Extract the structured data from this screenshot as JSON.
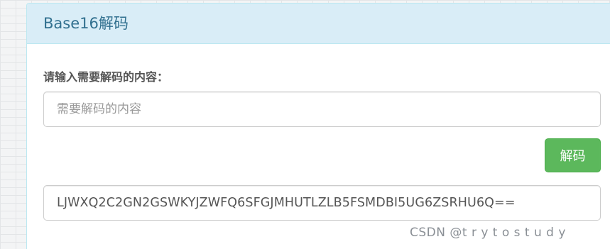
{
  "panel": {
    "title": "Base16解码"
  },
  "form": {
    "label": "请输入需要解码的内容：",
    "input_placeholder": "需要解码的内容",
    "input_value": "",
    "decode_button": "解码",
    "result_value": "LJWXQ2C2GN2GSWKYJZWFQ6SFGJMHUTLZLB5FSMDBI5UG6ZSRHU6Q=="
  },
  "watermark": "CSDN @t r y t o s t u d y",
  "colors": {
    "heading_bg": "#d9edf7",
    "heading_text": "#31708f",
    "button_bg": "#5cb85c"
  }
}
